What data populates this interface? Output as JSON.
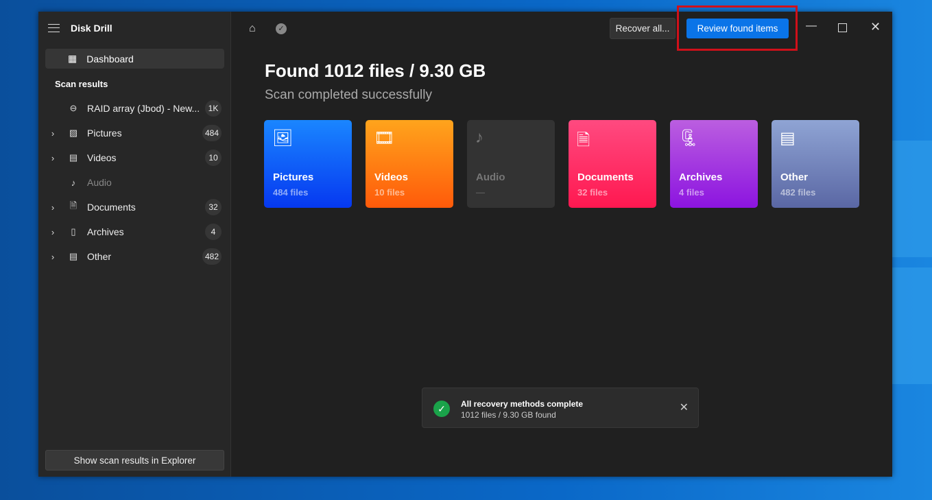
{
  "app": {
    "title": "Disk Drill"
  },
  "sidebar": {
    "dashboard": "Dashboard",
    "section": "Scan results",
    "items": [
      {
        "label": "RAID array (Jbod) - New...",
        "count": "1K",
        "icon": "drive-icon"
      },
      {
        "label": "Pictures",
        "count": "484",
        "icon": "picture-icon"
      },
      {
        "label": "Videos",
        "count": "10",
        "icon": "film-icon"
      },
      {
        "label": "Audio",
        "count": "",
        "icon": "music-icon"
      },
      {
        "label": "Documents",
        "count": "32",
        "icon": "document-icon"
      },
      {
        "label": "Archives",
        "count": "4",
        "icon": "archive-icon"
      },
      {
        "label": "Other",
        "count": "482",
        "icon": "file-icon"
      }
    ],
    "explorer_button": "Show scan results in Explorer"
  },
  "toolbar": {
    "recover": "Recover all...",
    "review": "Review found items"
  },
  "main": {
    "title": "Found 1012 files / 9.30 GB",
    "subtitle": "Scan completed successfully",
    "cards": [
      {
        "name": "Pictures",
        "count": "484 files",
        "colors": [
          "#1a86ff",
          "#0638f0"
        ]
      },
      {
        "name": "Videos",
        "count": "10 files",
        "colors": [
          "#ffa41c",
          "#ff5a0a"
        ]
      },
      {
        "name": "Audio",
        "count": "—",
        "colors": [
          "#333333",
          "#333333"
        ]
      },
      {
        "name": "Documents",
        "count": "32 files",
        "colors": [
          "#ff4a80",
          "#ff1850"
        ]
      },
      {
        "name": "Archives",
        "count": "4 files",
        "colors": [
          "#bb5ee0",
          "#8c14e0"
        ]
      },
      {
        "name": "Other",
        "count": "482 files",
        "colors": [
          "#8fa4d4",
          "#5a67a4"
        ]
      }
    ]
  },
  "toast": {
    "title": "All recovery methods complete",
    "detail": "1012 files / 9.30 GB found"
  }
}
